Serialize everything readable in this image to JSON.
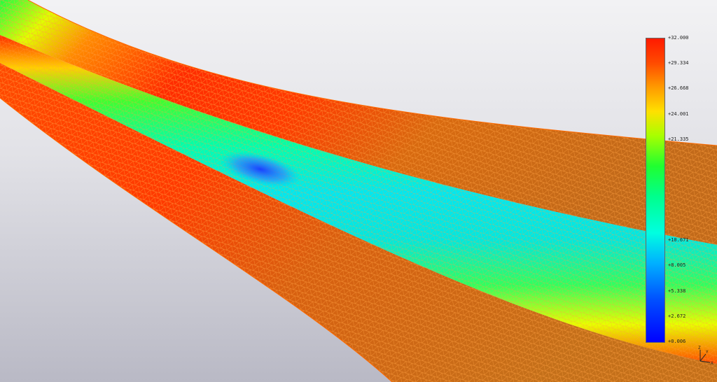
{
  "legend": {
    "ticks": [
      {
        "label": "+32.000",
        "value": 32.0
      },
      {
        "label": "+29.334",
        "value": 29.334
      },
      {
        "label": "+26.668",
        "value": 26.668
      },
      {
        "label": "+24.001",
        "value": 24.001
      },
      {
        "label": "+21.335",
        "value": 21.335
      },
      {
        "label": "+10.671",
        "value": 10.671
      },
      {
        "label": "+8.005",
        "value": 8.005
      },
      {
        "label": "+5.338",
        "value": 5.338
      },
      {
        "label": "+2.672",
        "value": 2.672
      },
      {
        "label": "+0.006",
        "value": 0.006
      }
    ],
    "min": 0.006,
    "max": 32.0
  },
  "triad": {
    "axis_z": "Z",
    "axis_y": "Y",
    "axis_x": "X"
  },
  "colors": {
    "high": "#ff2000",
    "mid": "#20ff30",
    "low": "#0000ff",
    "mesh": "#ff7a00",
    "flat_band": "#c86a10"
  }
}
